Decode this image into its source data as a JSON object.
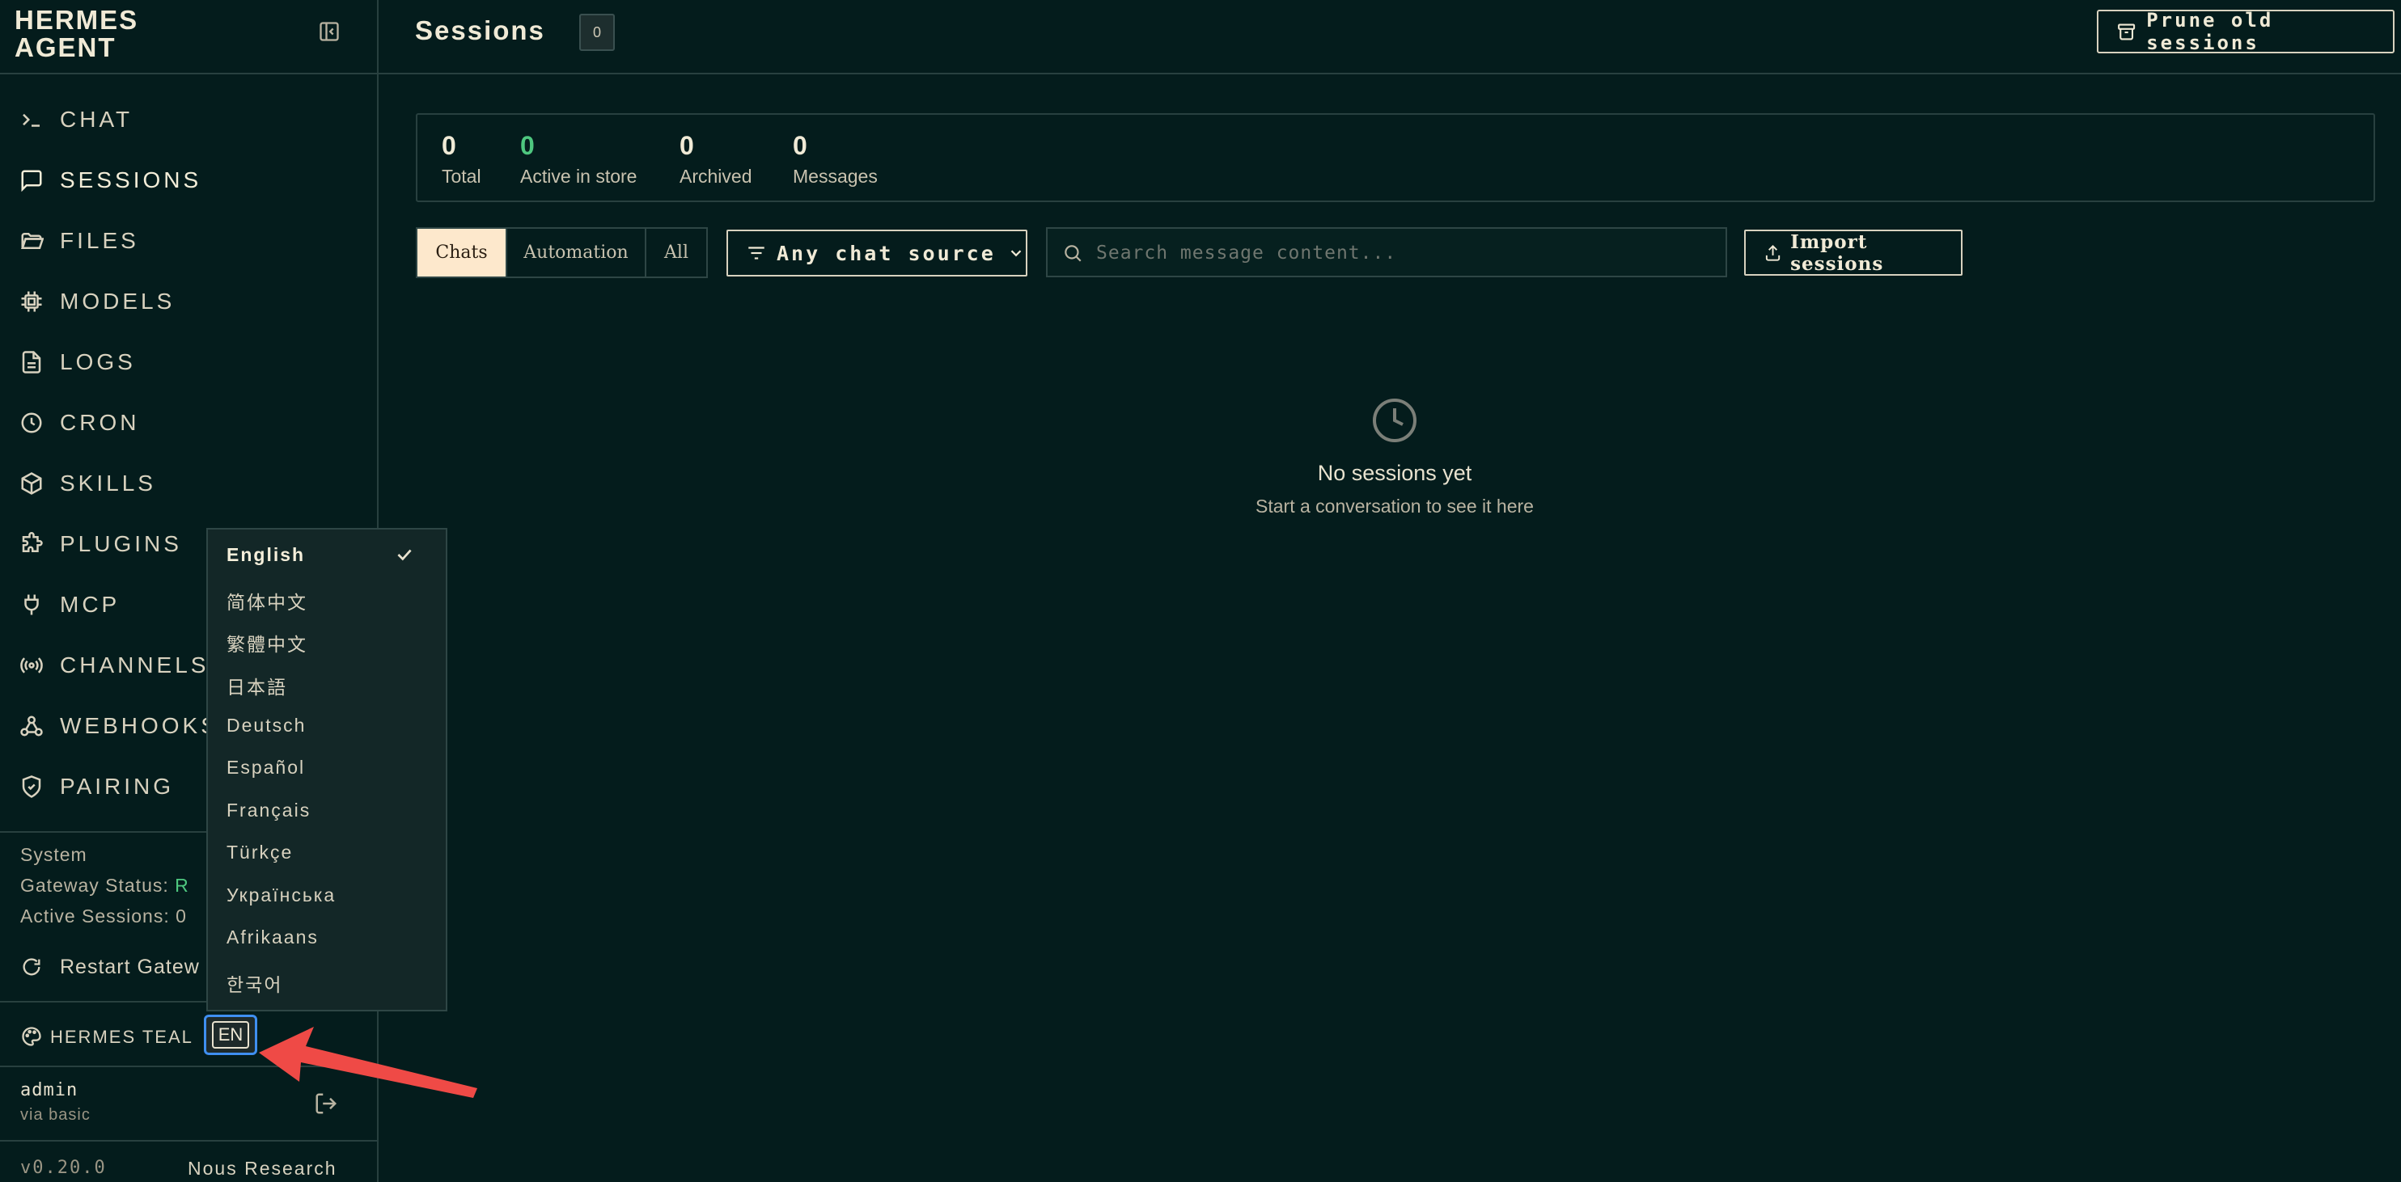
{
  "sidebar": {
    "brand": "HERMES AGENT",
    "nav": [
      {
        "label": "CHAT",
        "icon": "terminal-icon"
      },
      {
        "label": "SESSIONS",
        "icon": "message-square-icon"
      },
      {
        "label": "FILES",
        "icon": "folder-open-icon"
      },
      {
        "label": "MODELS",
        "icon": "cpu-chip-icon"
      },
      {
        "label": "LOGS",
        "icon": "file-text-icon"
      },
      {
        "label": "CRON",
        "icon": "clock-icon"
      },
      {
        "label": "SKILLS",
        "icon": "package-cube-icon"
      },
      {
        "label": "PLUGINS",
        "icon": "puzzle-icon"
      },
      {
        "label": "MCP",
        "icon": "plug-icon"
      },
      {
        "label": "CHANNELS",
        "icon": "radio-broadcast-icon"
      },
      {
        "label": "WEBHOOKS",
        "icon": "webhook-icon"
      },
      {
        "label": "PAIRING",
        "icon": "shield-check-icon"
      }
    ],
    "active_item": "SESSIONS",
    "system": {
      "heading": "System",
      "gateway_label": "Gateway Status:",
      "gateway_value": "R",
      "sessions_label": "Active Sessions:",
      "sessions_value": "0"
    },
    "restart_label": "Restart Gatew",
    "theme_label": "HERMES TEAL",
    "language_button": "EN",
    "user": {
      "name": "admin",
      "via": "via basic"
    },
    "version": "v0.20.0",
    "vendor": "Nous Research"
  },
  "header": {
    "title": "Sessions",
    "count_badge": "0",
    "prune_button": "Prune old sessions"
  },
  "stats": [
    {
      "value": "0",
      "label": "Total"
    },
    {
      "value": "0",
      "label": "Active in store"
    },
    {
      "value": "0",
      "label": "Archived"
    },
    {
      "value": "0",
      "label": "Messages"
    }
  ],
  "filters": {
    "tabs": [
      "Chats",
      "Automation",
      "All"
    ],
    "active_tab": "Chats",
    "source_select": "Any chat source",
    "search_placeholder": "Search message content...",
    "search_value": "",
    "import_button": "Import sessions"
  },
  "empty_state": {
    "title": "No sessions yet",
    "subtitle": "Start a conversation to see it here"
  },
  "language_menu": {
    "selected": "English",
    "options": [
      "English",
      "简体中文",
      "繁體中文",
      "日本語",
      "Deutsch",
      "Español",
      "Français",
      "Türkçe",
      "Українська",
      "Afrikaans",
      "한국어"
    ]
  },
  "colors": {
    "background": "#041c1c",
    "text": "#e8e2cf",
    "accent_green": "#4ec77f",
    "active_tab": "#fde8cc",
    "focus_ring": "#3f8ff0",
    "annotation_arrow": "#ef4a46"
  }
}
